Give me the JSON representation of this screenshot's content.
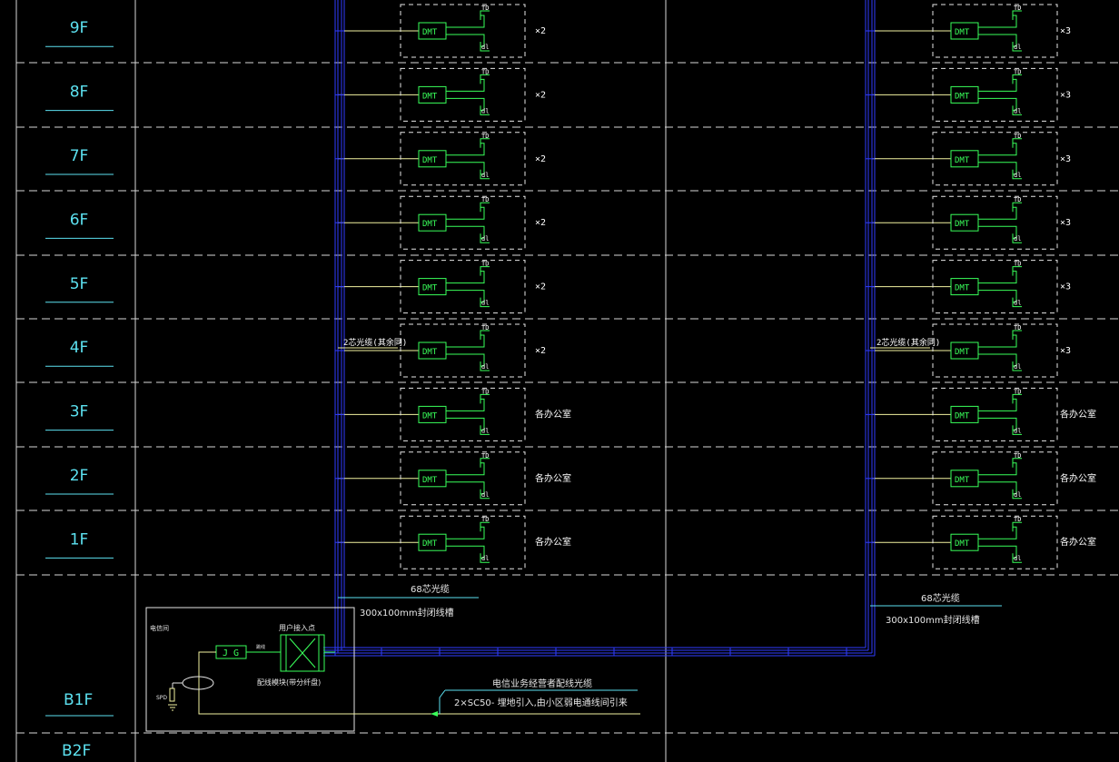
{
  "floors": [
    "9F",
    "8F",
    "7F",
    "6F",
    "5F",
    "4F",
    "3F",
    "2F",
    "1F"
  ],
  "basement": {
    "b1": "B1F",
    "b2": "B2F"
  },
  "device": {
    "dmt": "DMT",
    "td": "TD",
    "dl": "dl"
  },
  "left_multipliers": [
    "×2",
    "×2",
    "×2",
    "×2",
    "×2",
    "×2",
    "各办公室",
    "各办公室",
    "各办公室"
  ],
  "right_multipliers": [
    "×3",
    "×3",
    "×3",
    "×3",
    "×3",
    "×3",
    "各办公室",
    "各办公室",
    "各办公室"
  ],
  "cable_label": "2芯光缆(其余同)",
  "trunk": {
    "fiber": "68芯光缆",
    "tray": "300x100mm封闭线槽"
  },
  "telecom_room": {
    "title": "电信间",
    "jg": "J G",
    "user_point": "用户接入点",
    "jumper": "跳线",
    "patch_panel": "配线模块(带分纤盘)",
    "spd": "SPD"
  },
  "incoming": {
    "line1": "电信业务经营者配线光缆",
    "line2": "2×SC50- 埋地引入,由小区弱电通线间引来"
  },
  "colors": {
    "background": "#000000",
    "grid_line": "#ffffff",
    "floor_label": "#5ce1f0",
    "device": "#39ff5a",
    "tray": "#2f3cff",
    "feeder": "#f2f2a0",
    "dashed_box": "#ffffff"
  }
}
